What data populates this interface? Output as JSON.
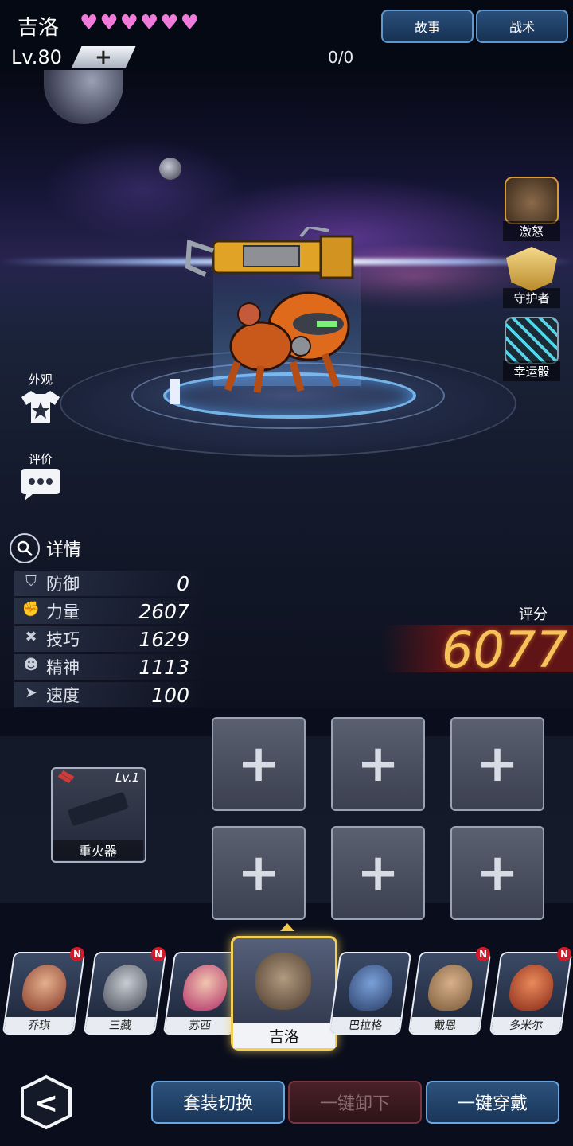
{
  "header": {
    "character_name": "吉洛",
    "hearts": [
      "♥",
      "♥",
      "♥",
      "♥",
      "♥",
      "♥"
    ],
    "level": "Lv.80",
    "level_plus": "+",
    "exp": "0/0",
    "story_btn": "故事",
    "tactics_btn": "战术"
  },
  "skills": [
    {
      "label": "激怒",
      "icon": "pug-face-icon"
    },
    {
      "label": "守护者",
      "icon": "guardian-emblem-icon"
    },
    {
      "label": "幸运骰",
      "icon": "dice-icon"
    }
  ],
  "side": {
    "appearance": "外观",
    "review": "评价"
  },
  "details": {
    "label": "详情",
    "stats": [
      {
        "label": "防御",
        "value": "0",
        "icon": "shield-icon"
      },
      {
        "label": "力量",
        "value": "2607",
        "icon": "fist-icon"
      },
      {
        "label": "技巧",
        "value": "1629",
        "icon": "tools-icon"
      },
      {
        "label": "精神",
        "value": "1113",
        "icon": "head-icon"
      },
      {
        "label": "速度",
        "value": "100",
        "icon": "speed-icon"
      }
    ]
  },
  "score": {
    "label": "评分",
    "value": "6077"
  },
  "equipment": {
    "weapon_name": "重火器",
    "weapon_level": "Lv.1",
    "slot_plus": "+"
  },
  "roster": [
    {
      "name": "乔琪",
      "badge": "N"
    },
    {
      "name": "三藏",
      "badge": "N"
    },
    {
      "name": "苏西",
      "badge": ""
    },
    {
      "name": "吉洛",
      "badge": "",
      "selected": true
    },
    {
      "name": "巴拉格",
      "badge": ""
    },
    {
      "name": "戴恩",
      "badge": "N"
    },
    {
      "name": "多米尔",
      "badge": "N"
    }
  ],
  "bottom": {
    "back": "<",
    "set_switch": "套装切换",
    "unequip_all": "一键卸下",
    "equip_all": "一键穿戴"
  },
  "colors": {
    "heart": "#f07ad9",
    "score": "#f6c25a",
    "accent": "#5f98cf"
  }
}
